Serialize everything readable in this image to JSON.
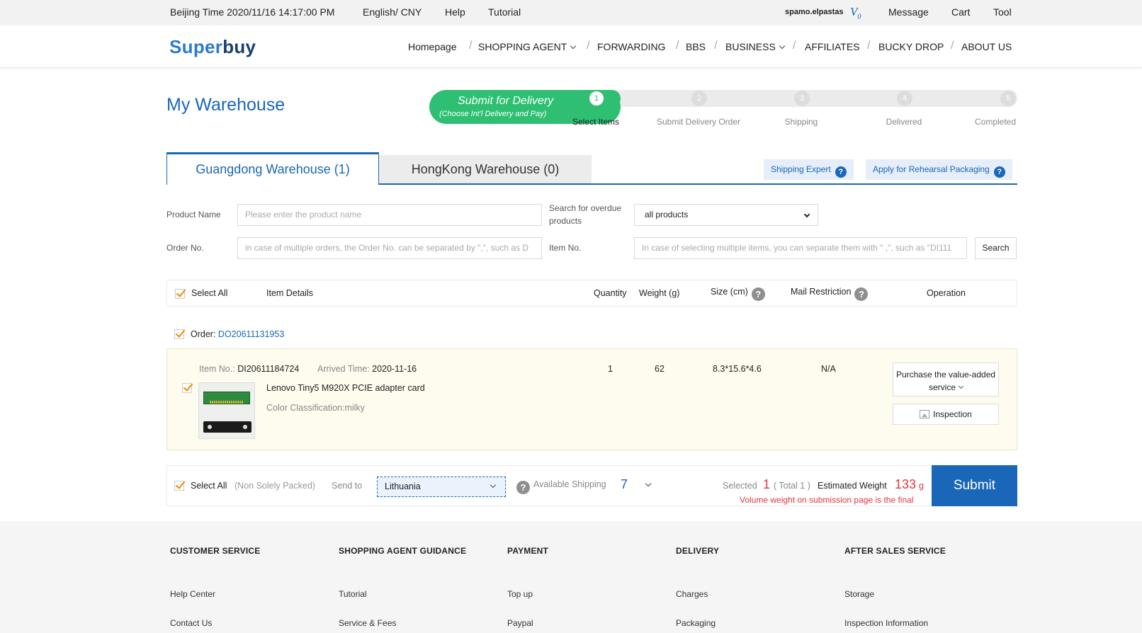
{
  "topbar": {
    "time": "Beijing Time 2020/11/16 14:17:00 PM",
    "lang": "English/ CNY",
    "help": "Help",
    "tutorial": "Tutorial",
    "username": "spamo.elpastas",
    "vip_label": "V",
    "vip_level": "0",
    "message": "Message",
    "cart": "Cart",
    "tool": "Tool"
  },
  "logo": {
    "part1": "Super",
    "part2": "buy"
  },
  "nav": {
    "homepage": "Homepage",
    "shopping_agent": "SHOPPING AGENT",
    "forwarding": "FORWARDING",
    "bbs": "BBS",
    "business": "BUSINESS",
    "affiliates": "AFFILIATES",
    "bucky_drop": "BUCKY DROP",
    "about_us": "ABOUT US",
    "sep": "/"
  },
  "page_title": "My Warehouse",
  "stepper": {
    "pill_title": "Submit for Delivery",
    "pill_subtitle": "(Choose Int'l Delivery and Pay)",
    "steps": [
      {
        "num": "1",
        "label": "Select Items"
      },
      {
        "num": "2",
        "label": "Submit Delivery Order"
      },
      {
        "num": "3",
        "label": "Shipping"
      },
      {
        "num": "4",
        "label": "Delivered"
      },
      {
        "num": "5",
        "label": "Completed"
      }
    ]
  },
  "tabs": {
    "guangdong": "Guangdong Warehouse  (1)",
    "hongkong": "HongKong Warehouse  (0)",
    "shipping_expert": "Shipping Expert",
    "rehearsal": "Apply for Rehearsal Packaging",
    "help_glyph": "?"
  },
  "filters": {
    "product_name_label": "Product Name",
    "product_name_placeholder": "Please enter the product name",
    "overdue_label_1": "Search for overdue",
    "overdue_label_2": "products",
    "overdue_value": "all products",
    "order_no_label": "Order No.",
    "order_no_placeholder": "in case of multiple orders, the Order No. can be separated by \",\", such as D",
    "item_no_label": "Item No.",
    "item_no_placeholder": "In case of selecting multiple items, you can separate them with \" ,\", such as \"DI111",
    "search": "Search"
  },
  "table_head": {
    "select_all": "Select All",
    "item_details": "Item Details",
    "quantity": "Quantity",
    "weight": "Weight (g)",
    "size": "Size (cm)",
    "mail_restriction": "Mail Restriction",
    "operation": "Operation",
    "help_glyph": "?"
  },
  "order": {
    "label": "Order:",
    "number": "DO20611131953"
  },
  "item": {
    "item_no_label": "Item No.:",
    "item_no": "DI20611184724",
    "arrived_label": "Arrived Time:",
    "arrived": "2020-11-16",
    "name": "Lenovo Tiny5 M920X PCIE adapter card",
    "color": "Color Classification:milky",
    "quantity": "1",
    "weight": "62",
    "size": "8.3*15.6*4.6",
    "mail_restriction": "N/A",
    "value_added_1": "Purchase the value-added",
    "value_added_2": "service",
    "inspection": "Inspection"
  },
  "bottom": {
    "select_all": "Select All",
    "non_solely": "(Non Solely Packed)",
    "send_to": "Send to",
    "country": "Lithuania",
    "available_shipping": "Available Shipping",
    "shipping_count": "7",
    "selected_label": "Selected",
    "selected_count": "1",
    "total": "( Total 1 )",
    "est_weight_label": "Estimated Weight",
    "est_weight": "133",
    "unit": "g",
    "volume_note": "Volume weight on submission page is the final",
    "submit": "Submit"
  },
  "footer": {
    "columns": [
      {
        "title": "CUSTOMER SERVICE",
        "links": [
          "Help Center",
          "Contact Us"
        ]
      },
      {
        "title": "SHOPPING AGENT GUIDANCE",
        "links": [
          "Tutorial",
          "Service & Fees"
        ]
      },
      {
        "title": "PAYMENT",
        "links": [
          "Top up",
          "Paypal"
        ]
      },
      {
        "title": "DELIVERY",
        "links": [
          "Charges",
          "Packaging"
        ]
      },
      {
        "title": "AFTER SALES SERVICE",
        "links": [
          "Storage",
          "Inspection Information"
        ]
      }
    ]
  },
  "colors": {
    "brand_blue": "#1a66b8",
    "step_green": "#2ebf72",
    "alert_red": "#e0383e",
    "check_orange": "#f08a00"
  }
}
